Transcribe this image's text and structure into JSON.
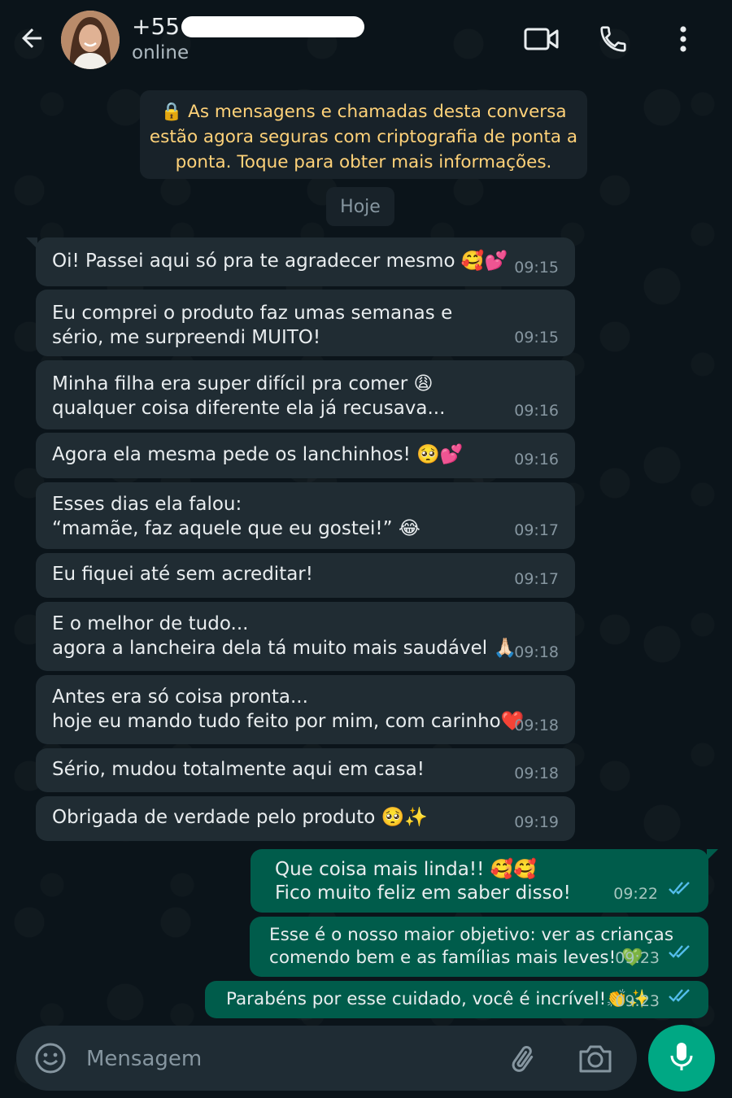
{
  "header": {
    "contact_name": "+55",
    "status": "online",
    "icons": [
      "back-arrow-icon",
      "avatar",
      "video-call-icon",
      "phone-icon",
      "more-vertical-icon"
    ]
  },
  "encryption_notice": {
    "line1": "As mensagens e chamadas desta conversa",
    "line2": "estão agora seguras com criptografia de ponta a",
    "line3": "ponta. Toque para obter mais informações."
  },
  "date_divider": "Hoje",
  "messages": [
    {
      "text": "Oi! Passei aqui só pra te agradecer mesmo 🥰💕",
      "time": "09:15",
      "dir": "in"
    },
    {
      "text": "Eu comprei o produto faz umas semanas e\nsério, me surpreendi MUITO!",
      "time": "09:15",
      "dir": "in"
    },
    {
      "text": "Minha filha era super difícil pra comer 😩\nqualquer coisa diferente ela já recusava...",
      "time": "09:16",
      "dir": "in"
    },
    {
      "text": "Agora ela mesma pede os lanchinhos! 🥺💕",
      "time": "09:16",
      "dir": "in"
    },
    {
      "text": "Esses dias ela falou:\n“mamãe, faz aquele que eu gostei!” 😂",
      "time": "09:17",
      "dir": "in"
    },
    {
      "text": "Eu fiquei até sem acreditar!",
      "time": "09:17",
      "dir": "in"
    },
    {
      "text": "E o melhor de tudo...\nagora a lancheira dela tá muito mais saudável 🙏🏻",
      "time": "09:18",
      "dir": "in"
    },
    {
      "text": "Antes era só coisa pronta...\nhoje eu mando tudo feito por mim, com carinho❤️",
      "time": "09:18",
      "dir": "in"
    },
    {
      "text": "Sério, mudou totalmente aqui em casa!",
      "time": "09:18",
      "dir": "in"
    },
    {
      "text": "Obrigada de verdade pelo produto 🥺✨",
      "time": "09:19",
      "dir": "in"
    },
    {
      "text": "Que coisa mais linda!!  🥰🥰\nFico muito feliz em saber disso!",
      "time": "09:22",
      "dir": "out"
    },
    {
      "text": "Esse é o nosso maior objetivo: ver as crianças\ncomendo bem e as famílias mais leves! 💚",
      "time": "09:23",
      "dir": "out"
    },
    {
      "text": "Parabéns por esse cuidado, você é incrível!👏✨",
      "time": "09:23",
      "dir": "out"
    }
  ],
  "composer": {
    "placeholder": "Mensagem",
    "icons": [
      "emoji-icon",
      "attach-icon",
      "camera-icon",
      "mic-icon"
    ]
  },
  "colors": {
    "background": "#0b141a",
    "incoming_bubble": "#202c33",
    "outgoing_bubble": "#005c4b",
    "notice_text": "#ffd279",
    "accent": "#00a884",
    "read_ticks": "#53bdeb"
  }
}
